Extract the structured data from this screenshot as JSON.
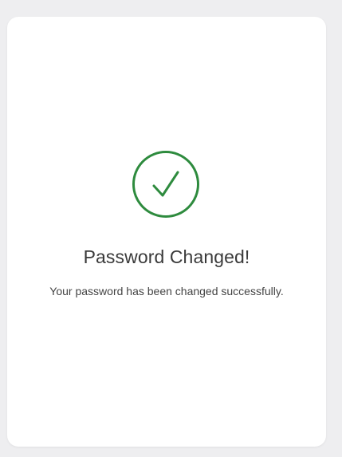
{
  "card": {
    "icon": "check-circle-icon",
    "title": "Password Changed!",
    "message": "Your password has been changed successfully."
  },
  "colors": {
    "success": "#2e8b3e",
    "background": "#eeeef0",
    "card": "#ffffff",
    "title_text": "#3a3a3a",
    "body_text": "#444444"
  }
}
